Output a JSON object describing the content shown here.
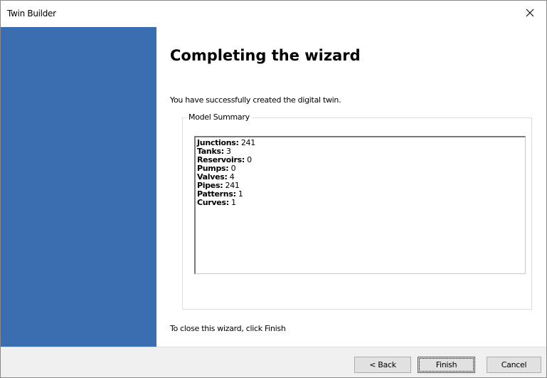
{
  "window": {
    "title": "Twin Builder",
    "close_glyph": "×"
  },
  "wizard": {
    "heading": "Completing the wizard",
    "intro": "You have successfully created the digital twin.",
    "summary_title": "Model Summary",
    "summary": [
      {
        "label": "Junctions:",
        "value": "241"
      },
      {
        "label": "Tanks:",
        "value": "3"
      },
      {
        "label": "Reservoirs:",
        "value": "0"
      },
      {
        "label": "Pumps:",
        "value": "0"
      },
      {
        "label": "Valves:",
        "value": "4"
      },
      {
        "label": "Pipes:",
        "value": "241"
      },
      {
        "label": "Patterns:",
        "value": "1"
      },
      {
        "label": "Curves:",
        "value": "1"
      }
    ],
    "footer": "To close this wizard, click Finish"
  },
  "buttons": {
    "back": "< Back",
    "finish": "Finish",
    "cancel": "Cancel"
  },
  "colors": {
    "side_panel": "#3a6eb0",
    "bottom_bar": "#f0f0f0",
    "default_button_border": "#0078d7"
  }
}
